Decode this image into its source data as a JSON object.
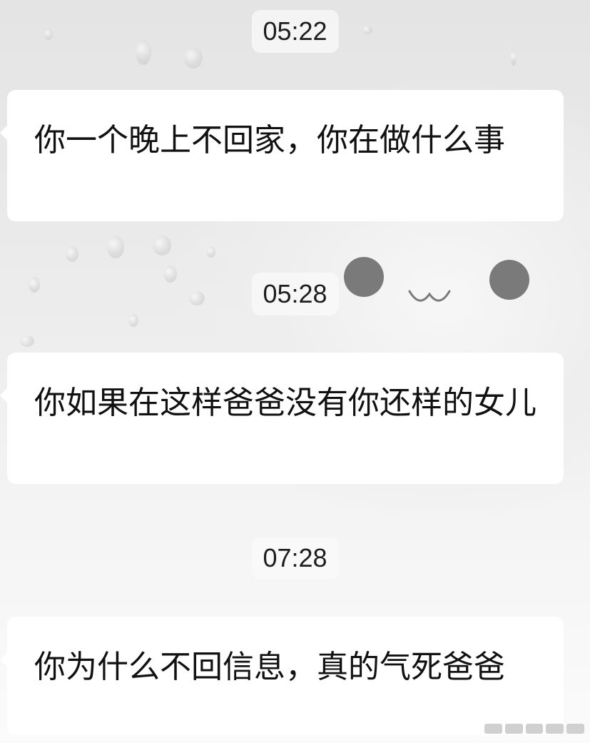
{
  "messages": [
    {
      "time": "05:22",
      "text": "你一个晚上不回家，你在做什么事"
    },
    {
      "time": "05:28",
      "text": "你如果在这样爸爸没有你还样的女儿"
    },
    {
      "time": "07:28",
      "text": "你为什么不回信息，真的气死爸爸"
    }
  ],
  "wallpaper": {
    "style": "raindrops-with-cute-face",
    "face_mouth": "ᴗ"
  },
  "colors": {
    "bubble": "#ffffff",
    "text": "#111111",
    "time_pill": "#fafafa"
  }
}
